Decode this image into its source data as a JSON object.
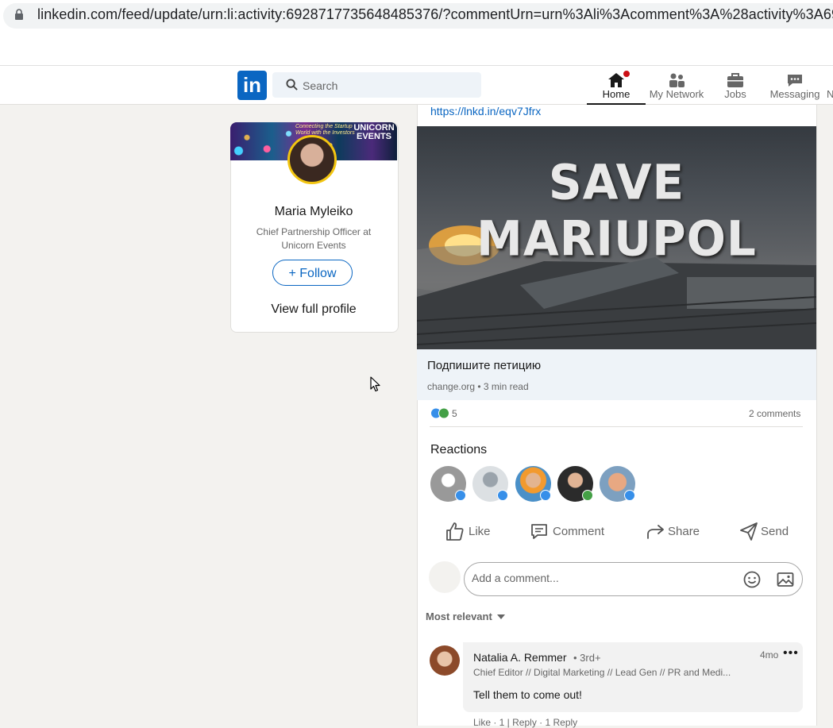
{
  "browser": {
    "url": "linkedin.com/feed/update/urn:li:activity:6928717735648485376/?commentUrn=urn%3Ali%3Acomment%3A%28activity%3A692871"
  },
  "nav": {
    "search_placeholder": "Search",
    "items": [
      {
        "label": "Home",
        "icon": "home-icon",
        "active": true
      },
      {
        "label": "My Network",
        "icon": "network-icon"
      },
      {
        "label": "Jobs",
        "icon": "briefcase-icon"
      },
      {
        "label": "Messaging",
        "icon": "messaging-icon"
      }
    ],
    "overflow_char": "N"
  },
  "profile": {
    "name": "Maria Myleiko",
    "title": "Chief Partnership Officer at Unicorn Events",
    "follow_label": "+ Follow",
    "view_profile_label": "View full profile",
    "banner_text": "Connecting the Startup World with the Investors",
    "banner_logo": "UNICORN EVENTS"
  },
  "post": {
    "link": "https://lnkd.in/eqv7Jfrx",
    "image_title": "SAVE MARIUPOL",
    "article_title": "Подпишите петицию",
    "article_meta": "change.org • 3 min read",
    "reaction_count": "5",
    "comments_count": "2 comments",
    "reactions_heading": "Reactions",
    "actions": [
      "Like",
      "Comment",
      "Share",
      "Send"
    ],
    "comment_placeholder": "Add a comment...",
    "sort_label": "Most relevant"
  },
  "comment": {
    "author": "Natalia A. Remmer",
    "degree": "• 3rd+",
    "time": "4mo",
    "more": "•••",
    "headline": "Chief Editor // Digital Marketing // Lead Gen // PR and Medi...",
    "text": "Tell them to come out!",
    "actions_line": "Like · 1 | Reply · 1 Reply"
  },
  "colors": {
    "brand": "#0a66c2",
    "background": "#f3f2ef",
    "notification": "#cc1016"
  }
}
